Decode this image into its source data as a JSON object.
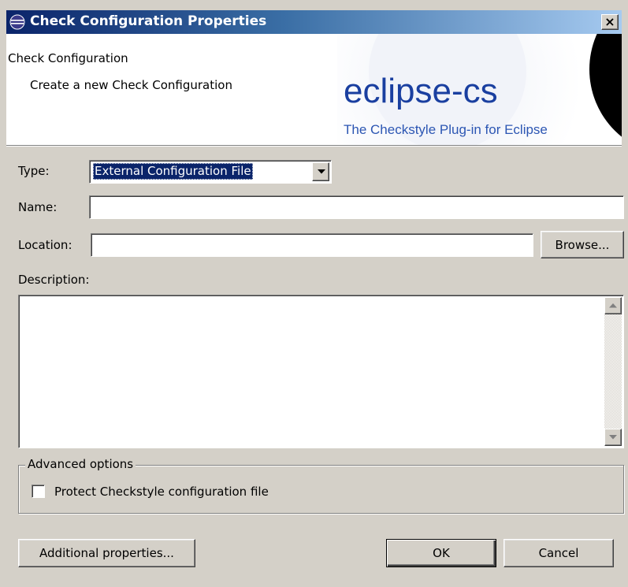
{
  "window": {
    "title": "Check Configuration Properties",
    "close_glyph": "×"
  },
  "banner": {
    "title": "Check Configuration",
    "message": "Create a new Check Configuration",
    "logo_text": "eclipse-cs",
    "tagline": "The Checkstyle Plug-in for Eclipse"
  },
  "form": {
    "type_label": "Type:",
    "type_value": "External Configuration File",
    "name_label": "Name:",
    "name_value": "",
    "location_label": "Location:",
    "location_value": "",
    "browse_label": "Browse...",
    "description_label": "Description:",
    "description_value": ""
  },
  "advanced": {
    "legend": "Advanced options",
    "protect_label": "Protect Checkstyle configuration file",
    "protect_checked": false
  },
  "buttons": {
    "additional_properties": "Additional properties...",
    "ok": "OK",
    "cancel": "Cancel"
  },
  "icons": {
    "app": "eclipse-icon",
    "close": "close-icon",
    "dropdown": "chevron-down-icon",
    "scroll_up": "arrow-up-icon",
    "scroll_down": "arrow-down-icon"
  },
  "colors": {
    "titlebar_start": "#0a246a",
    "titlebar_end": "#a6caf0",
    "dialog_bg": "#d4d0c8",
    "logo_blue": "#1a3fa0",
    "selection": "#0a246a"
  }
}
